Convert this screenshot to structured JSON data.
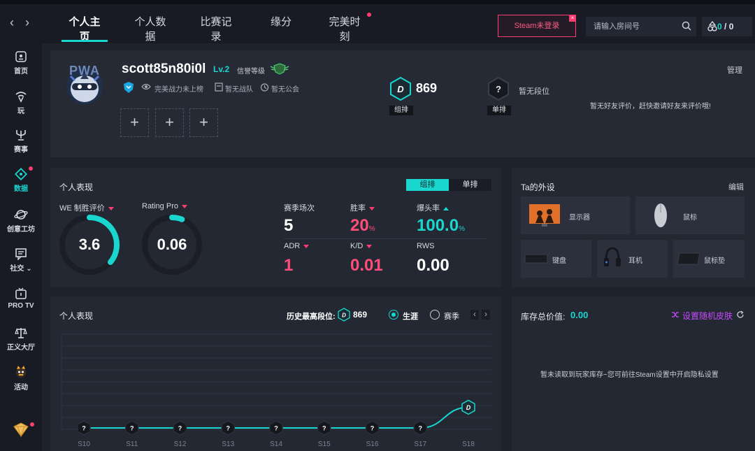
{
  "topbar": {
    "tabs": [
      "个人主页",
      "个人数据",
      "比赛记录",
      "缘分",
      "完美时刻"
    ],
    "steam_button": "Steam未登录",
    "room_placeholder": "请输入房间号",
    "coins_a": "0",
    "coins_sep": "/",
    "coins_b": "0",
    "accent_color": "#19d6cf",
    "alert_color": "#ff3d6e"
  },
  "sidebar": {
    "items": [
      {
        "label": "首页",
        "icon": "home-icon"
      },
      {
        "label": "玩",
        "icon": "wifi-icon"
      },
      {
        "label": "赛事",
        "icon": "trophy-icon"
      },
      {
        "label": "数据",
        "icon": "data-icon"
      },
      {
        "label": "创意工坊",
        "icon": "planet-icon"
      },
      {
        "label": "社交",
        "icon": "chat-icon"
      },
      {
        "label": "PRO TV",
        "icon": "tv-icon"
      },
      {
        "label": "正义大厅",
        "icon": "scale-icon"
      },
      {
        "label": "活动",
        "icon": "mascot-icon"
      }
    ],
    "bottom_icon": "gem-icon"
  },
  "profile": {
    "avatar_text": "PWA",
    "username": "scott85n80i0l",
    "level": "Lv.2",
    "honor_label": "信誉等级",
    "rank_status": "完美战力未上榜",
    "team_status": "暂无战队",
    "guild_status": "暂无公会",
    "group_score": "869",
    "group_label": "组排",
    "solo_label": "单排",
    "solo_status": "暂无段位",
    "manage": "管理",
    "friend_review": "暂无好友评价，赶快邀请好友来评价哦!"
  },
  "performance": {
    "title": "个人表现",
    "toggle": [
      "组排",
      "单排"
    ],
    "we_label": "WE 制胜评价",
    "we_value": "3.6",
    "we_fraction": 0.36,
    "rating_label": "Rating Pro",
    "rating_value": "0.06",
    "rating_fraction": 0.06,
    "season_games_label": "赛季场次",
    "season_games": "5",
    "winrate_label": "胜率",
    "winrate": "20",
    "headshot_label": "爆头率",
    "headshot": "100.0",
    "adr_label": "ADR",
    "adr": "1",
    "kd_label": "K/D",
    "kd": "0.01",
    "rws_label": "RWS",
    "rws": "0.00",
    "percent": "%"
  },
  "gear": {
    "title": "Ta的外设",
    "edit": "编辑",
    "items": [
      "显示器",
      "鼠标",
      "键盘",
      "耳机",
      "鼠标垫"
    ]
  },
  "history": {
    "title": "个人表现",
    "best_label": "历史最高段位:",
    "best_score": "869",
    "radio_career": "生涯",
    "radio_season": "赛季",
    "prev": "‹",
    "next": "›"
  },
  "chart_data": {
    "type": "line",
    "categories": [
      "S10",
      "S11",
      "S12",
      "S13",
      "S14",
      "S15",
      "S16",
      "S17",
      "S18"
    ],
    "values": [
      0,
      0,
      0,
      0,
      0,
      0,
      0,
      0,
      869
    ],
    "markers": [
      "?",
      "?",
      "?",
      "?",
      "?",
      "?",
      "?",
      "?",
      "D"
    ],
    "xlabel": "",
    "ylabel": "",
    "grid": true,
    "line_color": "#19d6cf"
  },
  "inventory": {
    "label": "库存总价值:",
    "value": "0.00",
    "random_skin": "设置随机皮肤",
    "message": "暂未读取到玩家库存~您可前往Steam设置中开启隐私设置",
    "skin_color": "#c64bff"
  }
}
